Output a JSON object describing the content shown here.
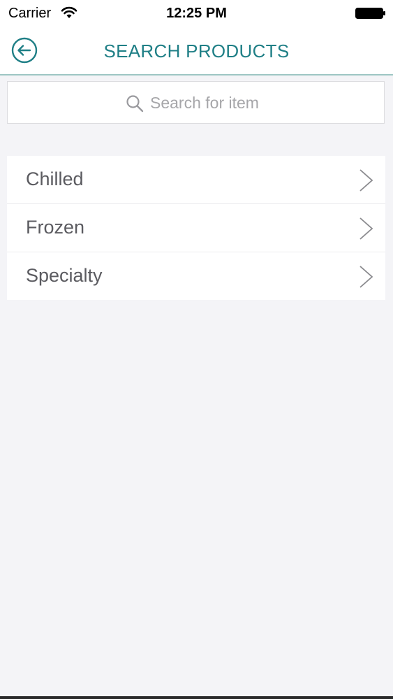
{
  "status_bar": {
    "carrier": "Carrier",
    "time": "12:25 PM",
    "icons": [
      "wifi-icon",
      "battery-icon"
    ]
  },
  "nav": {
    "title": "SEARCH PRODUCTS",
    "back_icon": "circle-arrow-left-icon",
    "accent_color": "#1f7f86"
  },
  "search": {
    "placeholder": "Search for item",
    "value": "",
    "icon": "search-icon"
  },
  "categories": {
    "items": [
      {
        "label": "Chilled",
        "icon": "chevron-right-icon"
      },
      {
        "label": "Frozen",
        "icon": "chevron-right-icon"
      },
      {
        "label": "Specialty",
        "icon": "chevron-right-icon"
      }
    ]
  },
  "colors": {
    "background": "#f4f4f7",
    "surface": "#ffffff",
    "text": "#5b5b60",
    "placeholder": "#a6a6a9"
  }
}
